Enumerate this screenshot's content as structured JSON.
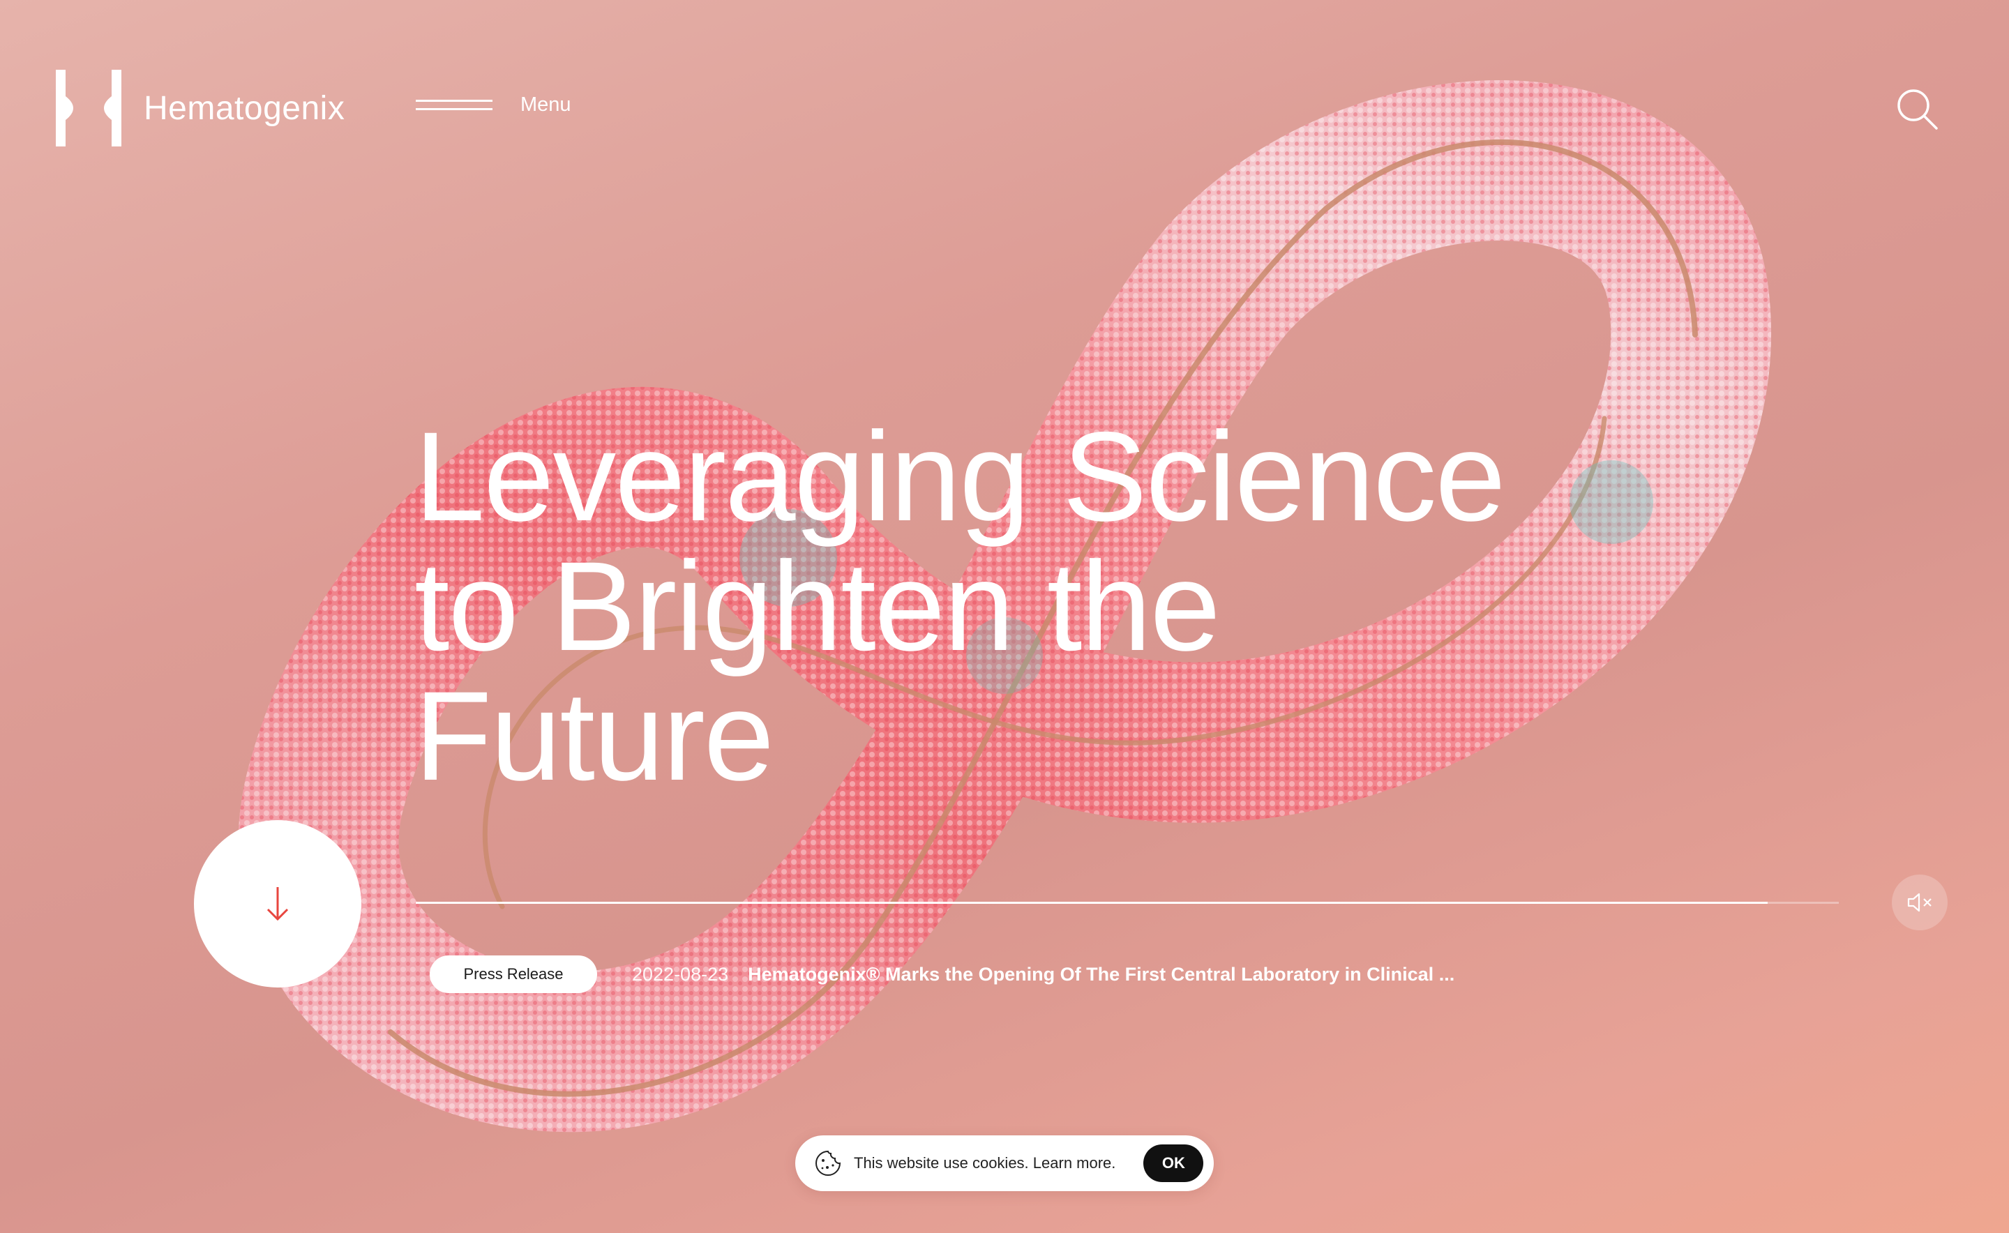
{
  "brand": {
    "name": "Hematogenix"
  },
  "nav": {
    "menu_label": "Menu"
  },
  "hero": {
    "headline_lines": [
      "Leveraging Science",
      "to Brighten the",
      "Future"
    ],
    "video_progress_percent": 95
  },
  "news": {
    "tag": "Press Release",
    "date": "2022-08-23",
    "title": "Hematogenix® Marks the Opening Of The First Central Laboratory in Clinical ..."
  },
  "cookie_banner": {
    "text": "This website use cookies. Learn more.",
    "ok_label": "OK"
  },
  "icons": {
    "search": "search-icon",
    "scroll_down": "arrow-down-icon",
    "mute": "speaker-muted-icon",
    "cookie": "cookie-icon"
  },
  "colors": {
    "background": "#dd9c95",
    "accent": "#e8463f",
    "text": "#ffffff"
  }
}
